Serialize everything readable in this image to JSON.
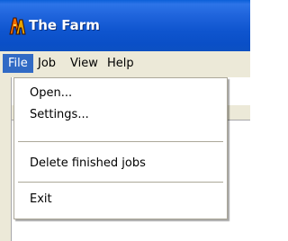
{
  "window": {
    "title": "The Farm",
    "icon": "the-farm-app-icon"
  },
  "menubar": {
    "items": [
      {
        "label": "File",
        "active": true
      },
      {
        "label": "Job",
        "active": false
      },
      {
        "label": "View",
        "active": false
      },
      {
        "label": "Help",
        "active": false
      }
    ]
  },
  "file_menu": {
    "items": [
      {
        "label": "Open..."
      },
      {
        "label": "Settings..."
      },
      {
        "separator": true
      },
      {
        "label": "Delete finished jobs"
      },
      {
        "separator": true
      },
      {
        "label": "Exit"
      }
    ]
  },
  "colors": {
    "titlebar": "#0f55cf",
    "menu_highlight": "#316ac5",
    "menubar_bg": "#ece9d8"
  }
}
